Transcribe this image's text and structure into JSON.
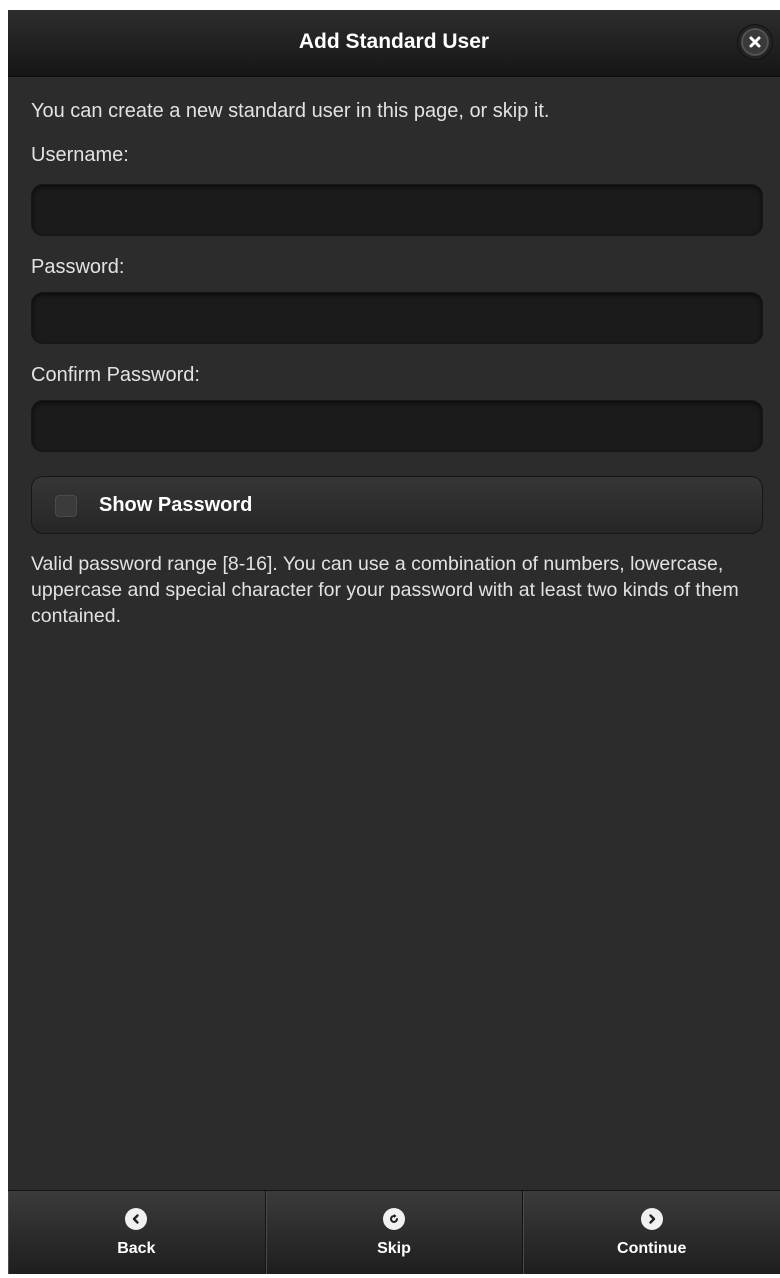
{
  "dialog": {
    "title": "Add Standard User",
    "close_icon": "close-icon",
    "intro": "You can create a new standard user in this page, or skip it.",
    "username": {
      "label": "Username:",
      "value": "",
      "placeholder": ""
    },
    "password": {
      "label": "Password:",
      "value": "",
      "placeholder": ""
    },
    "confirm_password": {
      "label": "Confirm Password:",
      "value": "",
      "placeholder": ""
    },
    "show_password": {
      "label": "Show Password",
      "checked": false
    },
    "hint": "Valid password range [8-16]. You can use a combination of numbers, lowercase, uppercase and special character for your password with at least two kinds of them contained."
  },
  "footer": {
    "back": {
      "label": "Back",
      "icon": "chevron-left-icon"
    },
    "skip": {
      "label": "Skip",
      "icon": "refresh-icon"
    },
    "continue": {
      "label": "Continue",
      "icon": "chevron-right-icon"
    }
  },
  "colors": {
    "background": "#2c2c2c",
    "header": "#161616",
    "field": "#1b1b1b",
    "text": "#e2e2e2"
  }
}
